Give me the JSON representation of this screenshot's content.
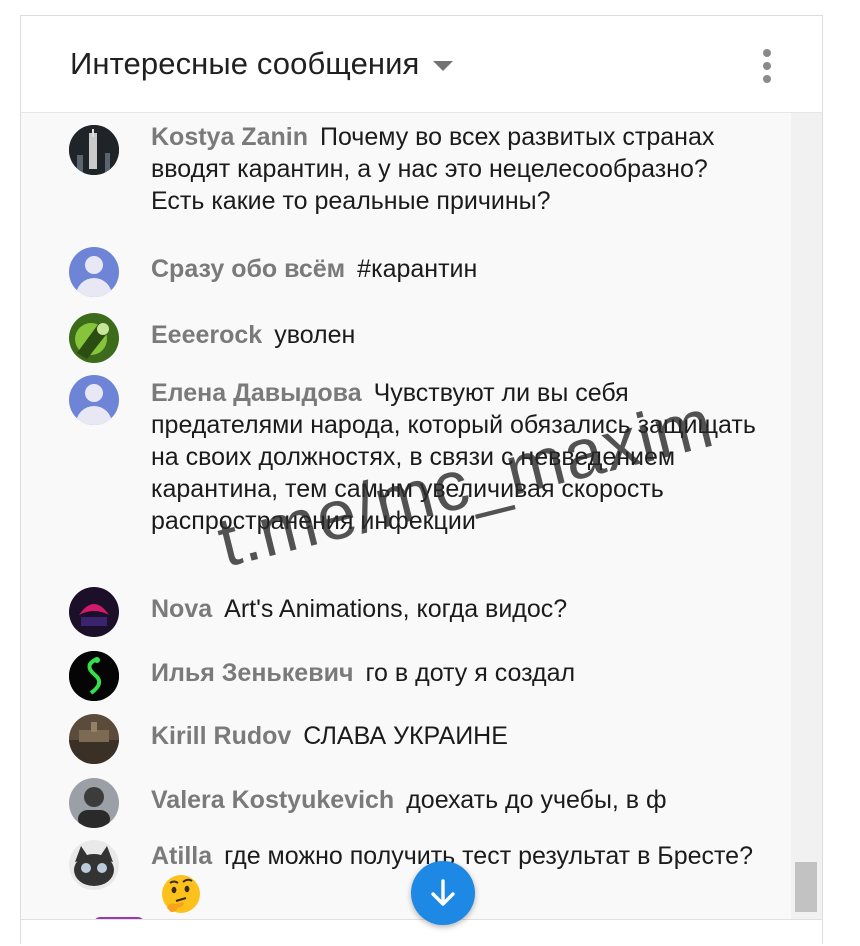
{
  "header": {
    "title": "Интересные сообщения"
  },
  "messages": [
    {
      "author": "Kostya Zanin",
      "text": "Почему во всех развитых странах вводят карантин, а у нас это нецелесообразно? Есть какие то реальные причины?"
    },
    {
      "author": "Сразу обо всём",
      "text": "#карантин"
    },
    {
      "author": "Eeeerock",
      "text": "уволен"
    },
    {
      "author": "Елена Давыдова",
      "text": "Чувствуют ли вы себя предателями народа, который обязались защищать на своих должностях, в связи с невведением карантина, тем самым увеличивая скорость распространения инфекции"
    },
    {
      "author": "Nova",
      "text": "Art's Animations, когда видос?"
    },
    {
      "author": "Илья Зенькевич",
      "text": "го в доту я создал"
    },
    {
      "author": "Kirill Rudov",
      "text": "СЛАВА УКРАИНЕ"
    },
    {
      "author": "Valera Kostyukevich",
      "text": "доехать до учебы, в ф"
    },
    {
      "author": "Atilla",
      "text": "где можно получить тест результат в Бресте?",
      "emoji": "thinking-face"
    }
  ],
  "watermark": "t.me/mc_maxim",
  "colors": {
    "accent": "#1e88e5",
    "author": "#7a7a7a",
    "default_avatar": "#6e84d6"
  }
}
